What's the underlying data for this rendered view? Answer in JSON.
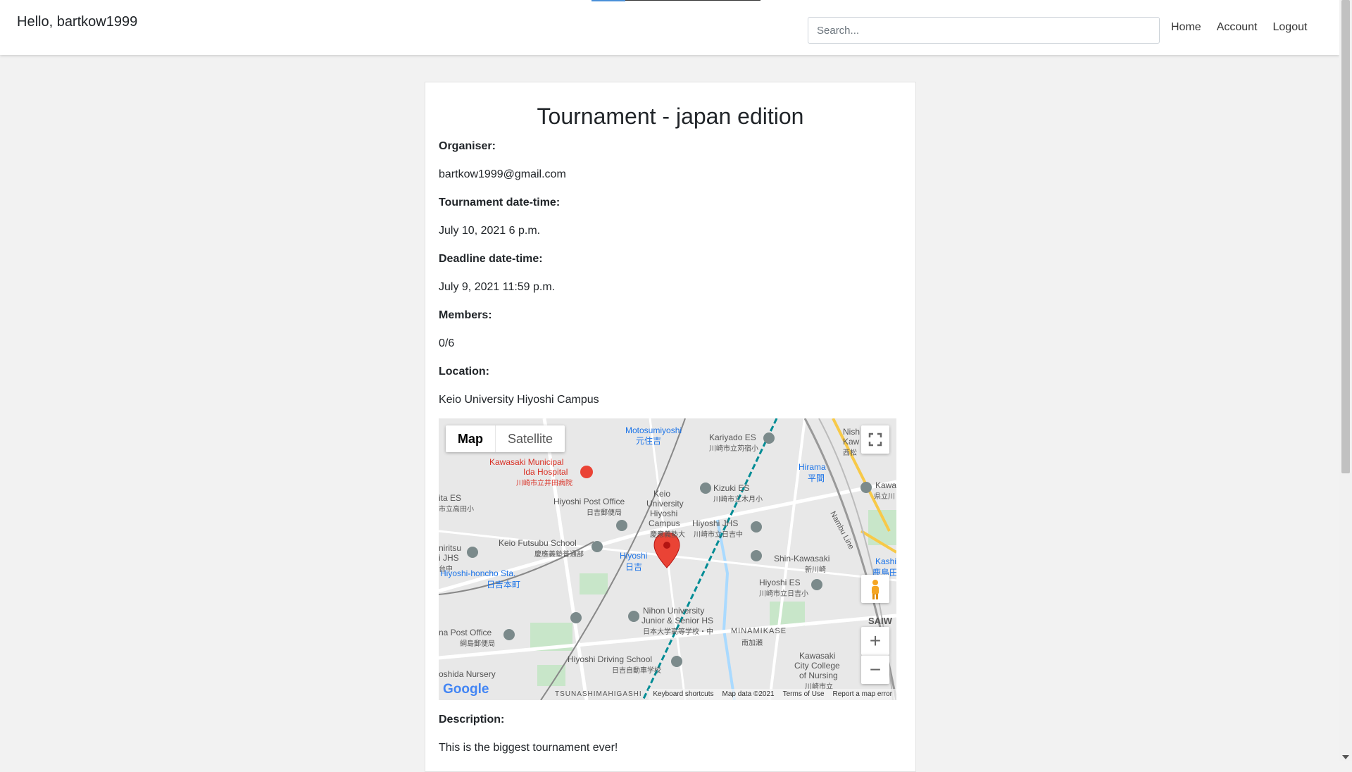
{
  "navbar": {
    "greeting": "Hello, bartkow1999",
    "search_placeholder": "Search...",
    "links": [
      "Home",
      "Account",
      "Logout"
    ],
    "progress": 0.2
  },
  "tournament": {
    "title": "Tournament - japan edition",
    "organiser_label": "Organiser:",
    "organiser": "bartkow1999@gmail.com",
    "date_label": "Tournament date-time:",
    "date": "July 10, 2021 6 p.m.",
    "deadline_label": "Deadline date-time:",
    "deadline": "July 9, 2021 11:59 p.m.",
    "members_label": "Members:",
    "members": "0/6",
    "location_label": "Location:",
    "location": "Keio University Hiyoshi Campus",
    "description_label": "Description:",
    "description": "This is the biggest tournament ever!"
  },
  "map": {
    "type_map": "Map",
    "type_satellite": "Satellite",
    "zoom_in": "+",
    "zoom_out": "−",
    "logo": "Google",
    "footer": [
      "Keyboard shortcuts",
      "Map data ©2021",
      "Terms of Use",
      "Report a map error"
    ],
    "labels": {
      "motosumiyoshi": "Motosumiyoshi",
      "motosumiyoshi_jp": "元住吉",
      "kariyado": "Kariyado ES",
      "kariyado_jp": "川崎市立苅宿小",
      "hospital": "Kawasaki Municipal",
      "hospital2": "Ida Hospital",
      "hospital_jp": "川崎市立井田病院",
      "post_office": "Hiyoshi Post Office",
      "post_office_jp": "日吉郵便局",
      "keio": "Keio",
      "keio2": "University",
      "keio3": "Hiyoshi",
      "keio4": "Campus",
      "keio_jp": "慶應義塾大",
      "kizuki": "Kizuki ES",
      "kizuki_jp": "川崎市立木月小",
      "hiyoshi_jhs": "Hiyoshi JHS",
      "hiyoshi_jhs_jp": "川崎市立日吉中",
      "fut": "Keio Futsubu School",
      "fut_jp": "慶應義塾普通部",
      "hiyoshi_sta": "Hiyoshi",
      "hiyoshi_sta_jp": "日吉",
      "honcho": "Hiyoshi-honcho Sta.",
      "honcho_jp": "日吉本町",
      "shin_kawasaki": "Shin-Kawasaki",
      "shin_kawasaki_jp": "新川崎",
      "hiyoshi_es": "Hiyoshi ES",
      "hiyoshi_es_jp": "川崎市立日吉小",
      "nihon": "Nihon University",
      "nihon2": "Junior & Senior HS",
      "nihon_jp": "日本大学高等学校・中",
      "minamikase": "MINAMIKASE",
      "minamikase_jp": "南加瀬",
      "post2": "na Post Office",
      "post2_jp": "綱島郵便局",
      "driving": "Hiyoshi Driving School",
      "driving_jp": "日吉自動車学校",
      "kcc": "Kawasaki",
      "kcc2": "City College",
      "kcc3": "of Nursing",
      "kcc_jp": "川崎市立",
      "nursery": "oshida Nursery",
      "tsunashima": "TSUNASHIMAHIGASHI",
      "hirama": "Hirama",
      "hirama_jp": "平間",
      "nambu": "Nambu Line",
      "saiw": "SAIW",
      "kashi": "Kashi",
      "kashi_jp": "鹿島田",
      "kawa": "Kawa",
      "kawa_jp": "県立川",
      "ita_es": "ita ES",
      "ita_es_jp": "市立高田小",
      "niritsu": "niritsu",
      "niritsu2": "i JHS",
      "niritsu_jp": "台中",
      "nish": "Nish",
      "kaw": "Kaw",
      "kaw_jp": "西松"
    },
    "colors": {
      "water": "#aadaff",
      "park": "#c8e6c9",
      "road": "#ffffff",
      "rail": "#008c95",
      "pin": "#ea4335"
    }
  }
}
